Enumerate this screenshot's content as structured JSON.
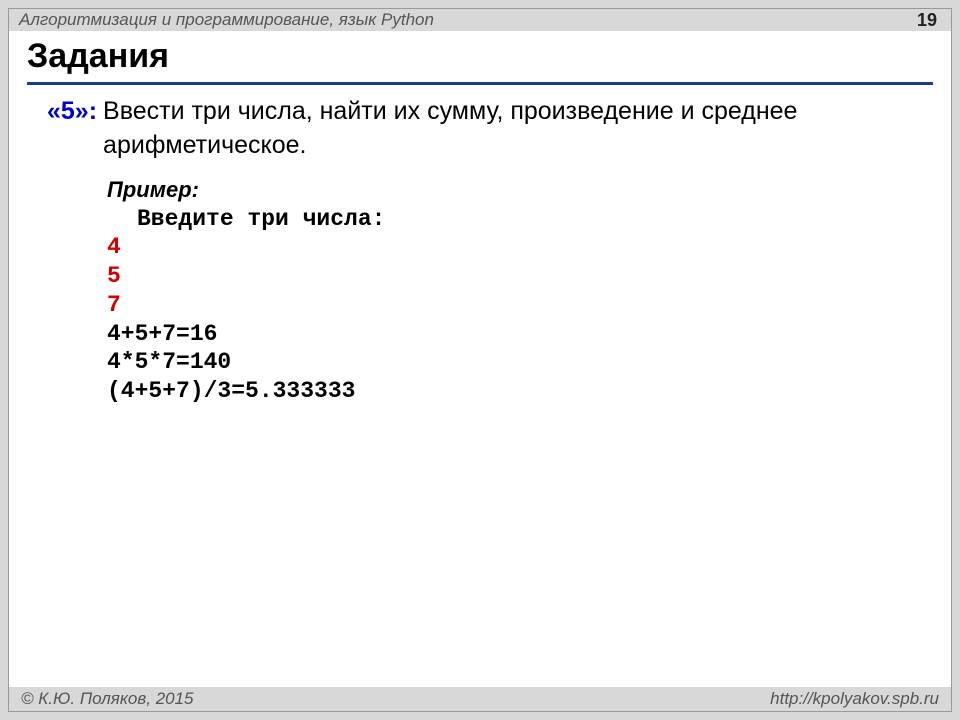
{
  "header": {
    "course_title": "Алгоритмизация и программирование, язык Python",
    "page_number": "19"
  },
  "slide": {
    "title": "Задания"
  },
  "task": {
    "grade_label": "«5»:",
    "description": "Ввести три числа, найти их сумму, произведение и среднее арифметическое."
  },
  "example": {
    "label": "Пример:",
    "prompt": "Введите три числа:",
    "inputs": [
      "4",
      "5",
      "7"
    ],
    "outputs": [
      "4+5+7=16",
      "4*5*7=140",
      "(4+5+7)/3=5.333333"
    ]
  },
  "footer": {
    "copyright": "© К.Ю. Поляков, 2015",
    "url": "http://kpolyakov.spb.ru"
  }
}
